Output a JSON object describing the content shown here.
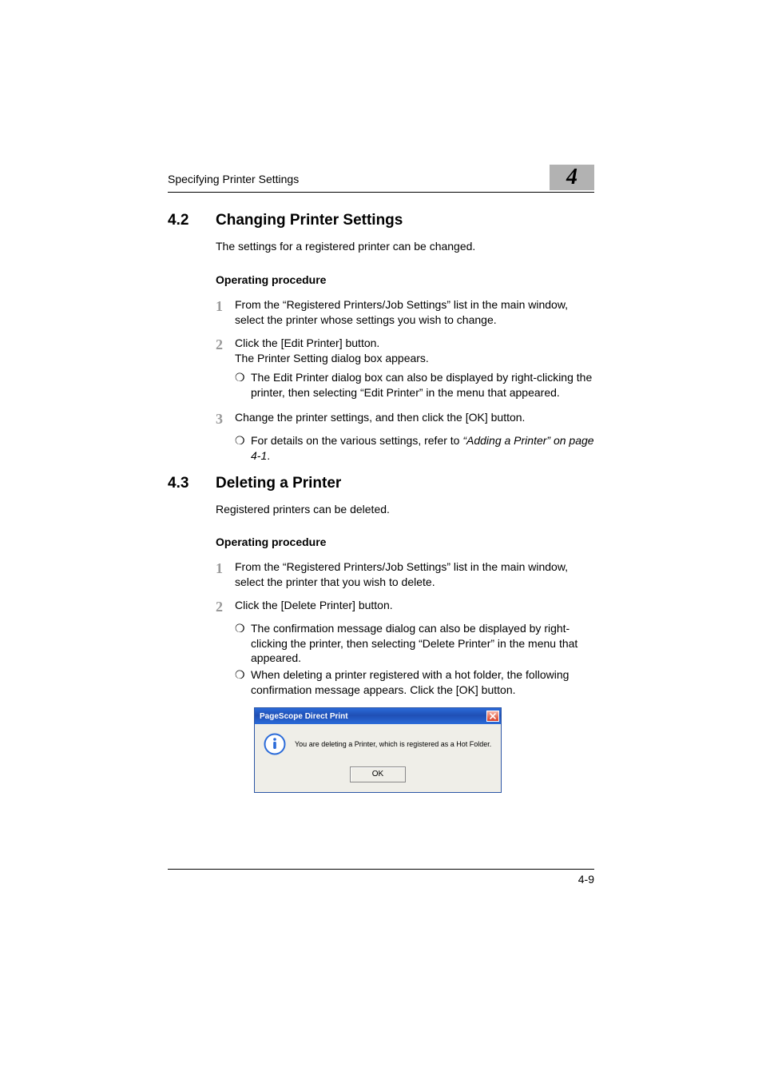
{
  "header": {
    "running_title": "Specifying Printer Settings",
    "chapter_number": "4"
  },
  "section42": {
    "num": "4.2",
    "title": "Changing Printer Settings",
    "intro": "The settings for a registered printer can be changed.",
    "proc_heading": "Operating procedure",
    "steps": [
      {
        "n": "1",
        "text": "From the “Registered Printers/Job Settings” list in the main window, select the printer whose settings you wish to change.",
        "bullets": []
      },
      {
        "n": "2",
        "text": "Click the [Edit Printer] button.",
        "text2": "The Printer Setting dialog box appears.",
        "bullets": [
          "The Edit Printer dialog box can also be displayed by right-clicking the printer, then selecting “Edit Printer” in the menu that appeared."
        ]
      },
      {
        "n": "3",
        "text": "Change the printer settings, and then click the [OK] button.",
        "bullets": [
          {
            "prefix": "For details on the various settings, refer to ",
            "ref": "“Adding a Printer” on page 4-1",
            "suffix": "."
          }
        ]
      }
    ]
  },
  "section43": {
    "num": "4.3",
    "title": "Deleting a Printer",
    "intro": "Registered printers can be deleted.",
    "proc_heading": "Operating procedure",
    "steps": [
      {
        "n": "1",
        "text": "From the “Registered Printers/Job Settings” list in the main window, select the printer that you wish to delete.",
        "bullets": []
      },
      {
        "n": "2",
        "text": "Click the [Delete Printer] button.",
        "bullets": [
          "The confirmation message dialog can also be displayed by right-clicking the printer, then selecting “Delete Printer” in the menu that appeared.",
          "When deleting a printer registered with a hot folder, the following confirmation message appears. Click the [OK] button."
        ]
      }
    ]
  },
  "dialog": {
    "title": "PageScope Direct Print",
    "message": "You are deleting a Printer, which is registered as a Hot Folder.",
    "ok": "OK"
  },
  "footer": {
    "page": "4-9"
  }
}
